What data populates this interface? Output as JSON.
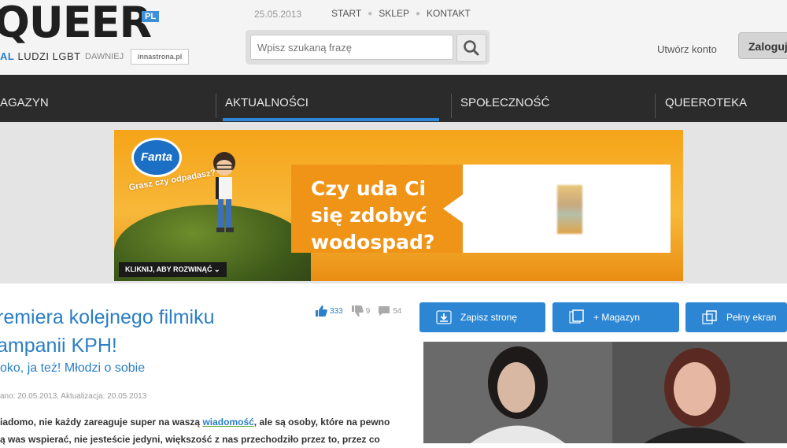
{
  "header": {
    "logo": "QUEER",
    "logo_badge": "PL",
    "tagline_blue": "AL",
    "tagline_rest": "LUDZI LGBT",
    "formerly_label": "DAWNIEJ",
    "formerly_logo": "innastrona.pl",
    "date": "25.05.2013",
    "top_links": [
      "START",
      "SKLEP",
      "KONTAKT"
    ],
    "search_placeholder": "Wpisz szukaną frazę",
    "create_account": "Utwórz konto",
    "login": "Zaloguj"
  },
  "nav": {
    "items": [
      "AGAZYN",
      "AKTUALNOŚCI",
      "SPOŁECZNOŚĆ",
      "QUEEROTEKA"
    ],
    "active": "AKTUALNOŚCI"
  },
  "banner": {
    "brand": "Fanta",
    "tagline": "Grasz czy odpadasz?",
    "headline_lines": [
      "Czy uda Ci",
      "się zdobyć",
      "wodospad?"
    ],
    "cta": "KLIKNIJ, ABY ROZWINĄĆ"
  },
  "article": {
    "title_line1": "remiera kolejnego filmiku",
    "title_line2": "ampanii KPH!",
    "subtitle": "oko, ja też! Młodzi o sobie",
    "meta": "ano: 20.05.2013, Aktualizacja: 20.05.2013",
    "body_line1_pre": "iadomo, nie każdy zareaguje super na waszą ",
    "body_line1_link": "wiadomość",
    "body_line1_post": ", ale są osoby, które na pewno",
    "body_line2": "ą was wspierać, nie jesteście jedyni, większość z nas przechodziło przez to, przez co",
    "likes": "333",
    "dislikes": "9",
    "comments": "54"
  },
  "actions": {
    "save_page": "Zapisz stronę",
    "add_magazine": "+ Magazyn",
    "fullscreen": "Pełny ekran"
  },
  "colors": {
    "accent": "#2c86d4",
    "nav_bg": "#2b2b2b",
    "banner_orange": "#ef9417"
  }
}
